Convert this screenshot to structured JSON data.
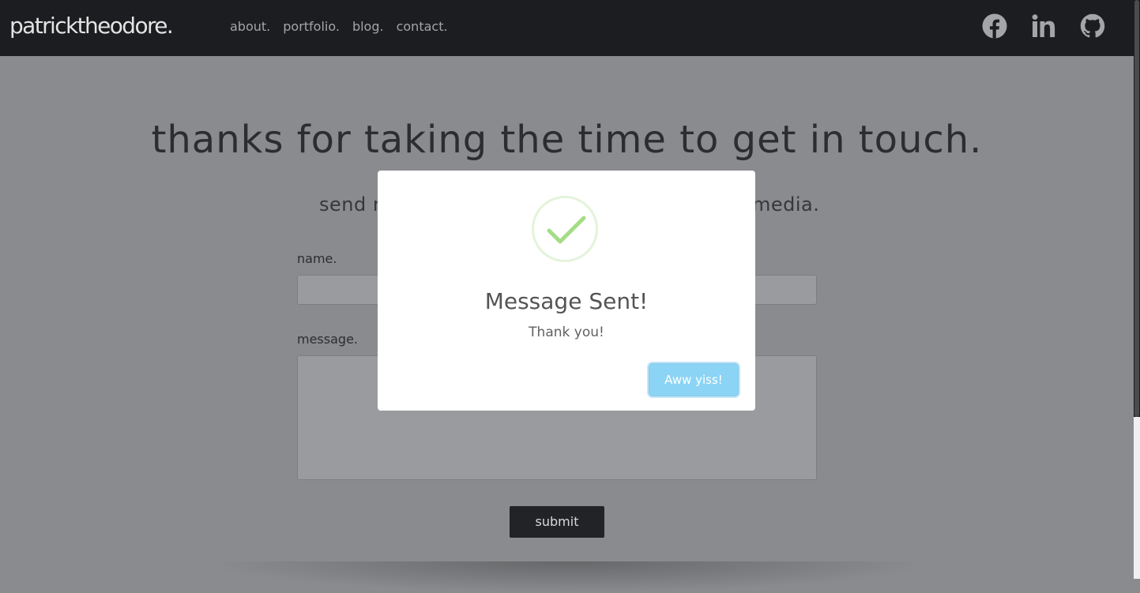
{
  "header": {
    "logo": "patricktheodore.",
    "nav": [
      "about.",
      "portfolio.",
      "blog.",
      "contact."
    ],
    "social_icons": [
      "facebook-icon",
      "linkedin-icon",
      "github-icon"
    ]
  },
  "main": {
    "title": "thanks for taking the time to get in touch.",
    "subtitle_left": "send m",
    "subtitle_right": "media.",
    "name_label": "name.",
    "message_label": "message.",
    "name_value": "",
    "message_value": "",
    "submit_label": "submit"
  },
  "modal": {
    "icon": "check-icon",
    "title": "Message Sent!",
    "text": "Thank you!",
    "button_label": "Aww yiss!"
  },
  "colors": {
    "topbar": "#1c1d20",
    "page_dimmed": "#8a8b8e",
    "check_green": "#a5dc86",
    "confirm_button": "#8cd4f5"
  }
}
